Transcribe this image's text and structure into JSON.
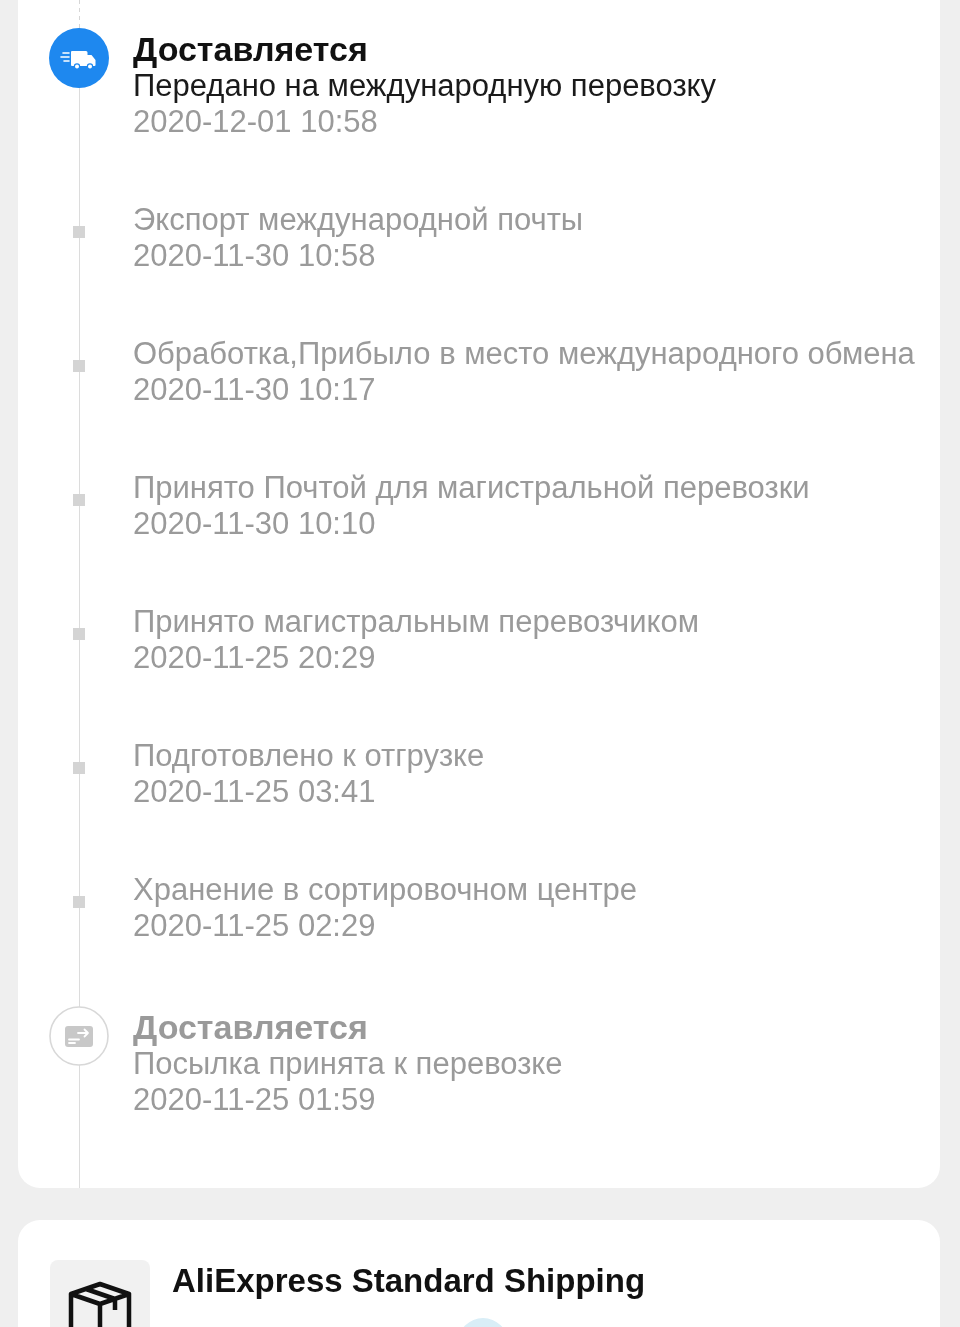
{
  "tracking": {
    "events": [
      {
        "kind": "transit",
        "active": true,
        "title": "Доставляется",
        "description": "Передано на международную перевозку",
        "date": "2020-12-01 10:58"
      },
      {
        "kind": "step",
        "active": false,
        "description": "Экспорт международной почты",
        "date": "2020-11-30 10:58"
      },
      {
        "kind": "step",
        "active": false,
        "description": "Обработка,Прибыло в место международного обмена",
        "date": "2020-11-30 10:17"
      },
      {
        "kind": "step",
        "active": false,
        "description": "Принято Почтой для магистральной перевозки",
        "date": "2020-11-30 10:10"
      },
      {
        "kind": "step",
        "active": false,
        "description": "Принято магистральным перевозчиком",
        "date": "2020-11-25 20:29"
      },
      {
        "kind": "step",
        "active": false,
        "description": "Подготовлено к отгрузке",
        "date": "2020-11-25 03:41"
      },
      {
        "kind": "step",
        "active": false,
        "description": "Хранение в сортировочном центре",
        "date": "2020-11-25 02:29"
      },
      {
        "kind": "accepted",
        "active": false,
        "title": "Доставляется",
        "description": "Посылка принята к перевозке",
        "date": "2020-11-25 01:59"
      }
    ]
  },
  "shipping": {
    "carrier": "AliExpress Standard Shipping"
  }
}
